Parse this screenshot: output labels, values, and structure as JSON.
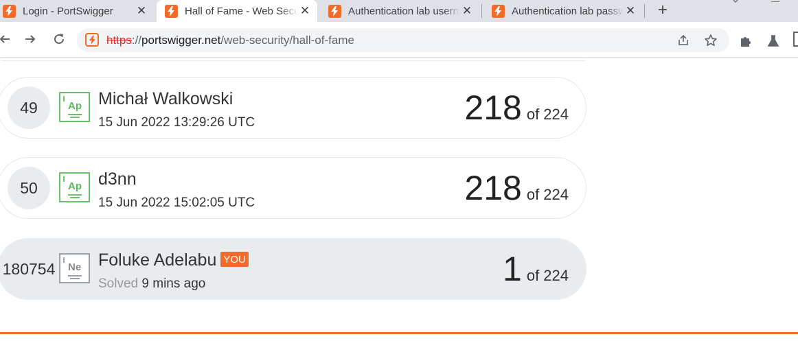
{
  "tabs": [
    {
      "title": "Login - PortSwigger",
      "close": "✕",
      "active": false
    },
    {
      "title": "Hall of Fame - Web Security Academy",
      "close": "✕",
      "active": true
    },
    {
      "title": "Authentication lab usernames",
      "close": "✕",
      "active": false
    },
    {
      "title": "Authentication lab passwords",
      "close": "✕",
      "active": false
    }
  ],
  "new_tab": "+",
  "address_bar": {
    "scheme": "https",
    "separator": "://",
    "host": "portswigger.net",
    "path": "/web-security/hall-of-fame"
  },
  "leaderboard": [
    {
      "rank": "49",
      "badge": "Ap",
      "name": "Michał Walkowski",
      "date": "15 Jun 2022 13:29:26 UTC",
      "solved": "218",
      "total": "of 224",
      "is_you": false
    },
    {
      "rank": "50",
      "badge": "Ap",
      "name": "d3nn",
      "date": "15 Jun 2022 15:02:05 UTC",
      "solved": "218",
      "total": "of 224",
      "is_you": false
    },
    {
      "rank": "180754",
      "badge": "Ne",
      "name": "Foluke Adelabu",
      "you_tag": "YOU",
      "solved_label": "Solved",
      "ago": "9 mins ago",
      "solved": "1",
      "total": "of 224",
      "is_you": true
    }
  ],
  "colors": {
    "brand": "#f26b2b",
    "badge_green": "#6bc06b",
    "row_highlight": "#e9ecef"
  },
  "icons": [
    "portswigger-logo-icon",
    "back-arrow-icon",
    "forward-arrow-icon",
    "reload-icon",
    "share-icon",
    "star-icon",
    "extensions-puzzle-icon",
    "labs-flask-icon"
  ]
}
